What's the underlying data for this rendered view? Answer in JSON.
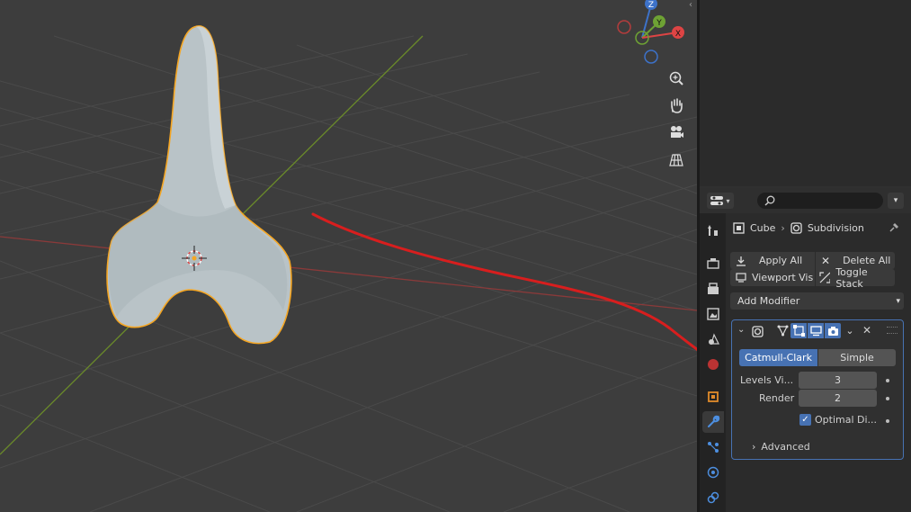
{
  "breadcrumb": {
    "object": "Cube",
    "modifier": "Subdivision"
  },
  "buttons": {
    "apply_all": "Apply All",
    "delete_all": "Delete All",
    "viewport_vis": "Viewport Vis",
    "toggle_stack": "Toggle Stack",
    "add_modifier": "Add Modifier"
  },
  "modifier": {
    "name": "Subdivision",
    "mode_catmull": "Catmull-Clark",
    "mode_simple": "Simple",
    "active_mode": "Catmull-Clark",
    "levels_label": "Levels Vi...",
    "levels_value": "3",
    "render_label": "Render",
    "render_value": "2",
    "optimal_label": "Optimal Di...",
    "optimal_checked": true,
    "advanced_label": "Advanced"
  },
  "gizmo": {
    "z": "Z",
    "y": "Y",
    "x": "X"
  },
  "colors": {
    "accent": "#4772b3",
    "selection_outline": "#f5a623",
    "x_axis": "#c0392b",
    "y_axis": "#5d8a2a",
    "annotation": "#d81e1e"
  },
  "icons": {
    "viewport_nav": [
      "zoom-icon",
      "hand-pan-icon",
      "camera-icon",
      "perspective-grid-icon"
    ],
    "tabs": [
      "tool-icon",
      "render-icon",
      "output-icon",
      "view-layer-icon",
      "scene-icon",
      "world-icon",
      "object-icon",
      "modifier-wrench-icon",
      "particles-icon",
      "physics-icon",
      "constraints-icon"
    ]
  }
}
